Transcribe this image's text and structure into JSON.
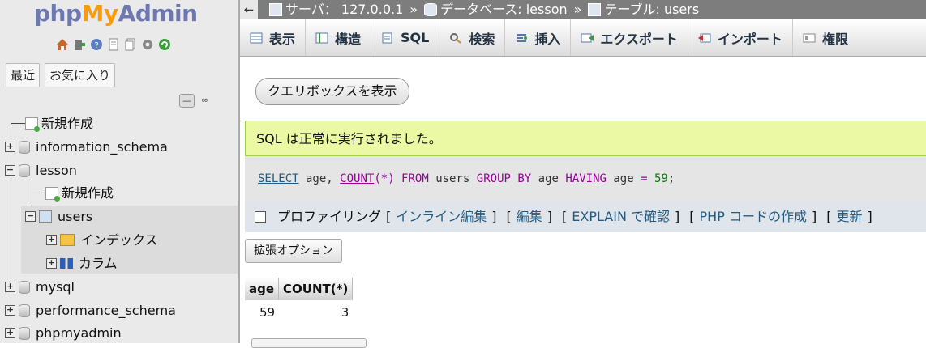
{
  "sidebar": {
    "logo": {
      "php": "php",
      "my": "My",
      "admin": "Admin"
    },
    "icons": [
      "home-icon",
      "exit-icon",
      "help-icon",
      "docs-icon",
      "copy-icon",
      "settings-icon",
      "reload-icon"
    ],
    "tabs": [
      "最近",
      "お気に入り"
    ],
    "tree": [
      {
        "label": "新規作成"
      },
      {
        "label": "information_schema"
      },
      {
        "label": "lesson"
      },
      {
        "label": "新規作成"
      },
      {
        "label": "users"
      },
      {
        "label": "インデックス"
      },
      {
        "label": "カラム"
      },
      {
        "label": "mysql"
      },
      {
        "label": "performance_schema"
      },
      {
        "label": "phpmyadmin"
      }
    ]
  },
  "breadcrumb": {
    "back": "←",
    "server": "サーバ： 127.0.0.1",
    "database": "データベース: lesson",
    "table": "テーブル: users",
    "separator": "»"
  },
  "menu": {
    "tabs": [
      {
        "label": "表示",
        "icon": "browse-icon"
      },
      {
        "label": "構造",
        "icon": "structure-icon"
      },
      {
        "label": "SQL",
        "icon": "sql-icon"
      },
      {
        "label": "検索",
        "icon": "search-icon"
      },
      {
        "label": "挿入",
        "icon": "insert-icon"
      },
      {
        "label": "エクスポート",
        "icon": "export-icon"
      },
      {
        "label": "インポート",
        "icon": "import-icon"
      },
      {
        "label": "権限",
        "icon": "privileges-icon"
      }
    ]
  },
  "content": {
    "query_box_button": "クエリボックスを表示",
    "success_message": "SQL は正常に実行されました。",
    "sql": {
      "select": "SELECT",
      "cols": " age, ",
      "count": "COUNT",
      "paren_open": "(",
      "star": "*",
      "paren_close": ")",
      "from": " FROM ",
      "table": "users ",
      "group_by": "GROUP BY",
      "group_col": " age ",
      "having": "HAVING",
      "having_col": " age ",
      "eq": "=",
      "value": " 59",
      "semicolon": ";"
    },
    "tools": {
      "profiling": "プロファイリング",
      "inline_edit": "インライン編集",
      "edit": "編集",
      "explain": "EXPLAIN で確認",
      "php_code": "PHP コードの作成",
      "refresh": "更新",
      "open": "[",
      "close": "]"
    },
    "extended_options": "拡張オプション",
    "result": {
      "headers": [
        "age",
        "COUNT(*)"
      ],
      "rows": [
        [
          "59",
          "3"
        ]
      ]
    }
  }
}
